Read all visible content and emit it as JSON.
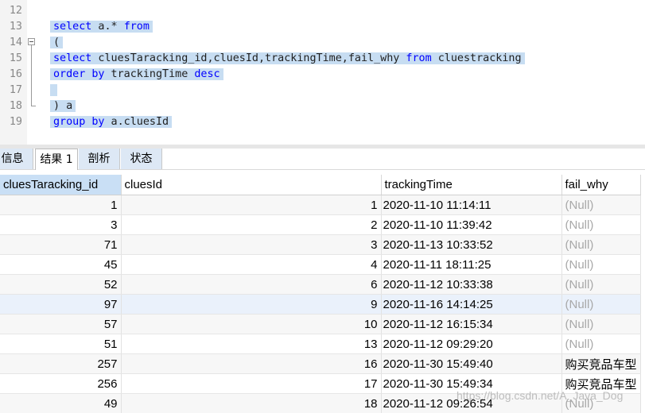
{
  "editor": {
    "line_numbers": [
      "12",
      "13",
      "14",
      "15",
      "16",
      "17",
      "18",
      "19"
    ],
    "lines": [
      {
        "num": "12",
        "tokens": []
      },
      {
        "num": "13",
        "tokens": [
          {
            "t": "select",
            "k": true
          },
          {
            "t": " a.* ",
            "k": false
          },
          {
            "t": "from",
            "k": true
          }
        ]
      },
      {
        "num": "14",
        "tokens": [
          {
            "t": "(",
            "k": false
          }
        ]
      },
      {
        "num": "15",
        "tokens": [
          {
            "t": "select",
            "k": true
          },
          {
            "t": " cluesTaracking_id,cluesId,trackingTime,fail_why ",
            "k": false
          },
          {
            "t": "from",
            "k": true
          },
          {
            "t": " cluestracking",
            "k": false
          }
        ]
      },
      {
        "num": "16",
        "tokens": [
          {
            "t": "order",
            "k": true
          },
          {
            "t": " ",
            "k": false
          },
          {
            "t": "by",
            "k": true
          },
          {
            "t": " trackingTime ",
            "k": false
          },
          {
            "t": "desc",
            "k": true
          }
        ]
      },
      {
        "num": "17",
        "tokens": []
      },
      {
        "num": "18",
        "tokens": [
          {
            "t": ") a",
            "k": false
          }
        ]
      },
      {
        "num": "19",
        "tokens": [
          {
            "t": "group",
            "k": true
          },
          {
            "t": " ",
            "k": false
          },
          {
            "t": "by",
            "k": true
          },
          {
            "t": " a.cluesId",
            "k": false
          }
        ]
      }
    ]
  },
  "tabs": {
    "info": "信息",
    "result": "结果 1",
    "profile": "剖析",
    "status": "状态"
  },
  "grid": {
    "columns": [
      "cluesTaracking_id",
      "cluesId",
      "trackingTime",
      "fail_why"
    ],
    "rows": [
      [
        "1",
        "1",
        "2020-11-10 11:14:11",
        "(Null)"
      ],
      [
        "3",
        "2",
        "2020-11-10 11:39:42",
        "(Null)"
      ],
      [
        "71",
        "3",
        "2020-11-13 10:33:52",
        "(Null)"
      ],
      [
        "45",
        "4",
        "2020-11-11 18:11:25",
        "(Null)"
      ],
      [
        "52",
        "6",
        "2020-11-12 10:33:38",
        "(Null)"
      ],
      [
        "97",
        "9",
        "2020-11-16 14:14:25",
        "(Null)"
      ],
      [
        "57",
        "10",
        "2020-11-12 16:15:34",
        "(Null)"
      ],
      [
        "51",
        "13",
        "2020-11-12 09:29:20",
        "(Null)"
      ],
      [
        "257",
        "16",
        "2020-11-30 15:49:40",
        "购买竞品车型"
      ],
      [
        "256",
        "17",
        "2020-11-30 15:49:34",
        "购买竞品车型"
      ],
      [
        "49",
        "18",
        "2020-11-12 09:26:54",
        "(Null)"
      ]
    ]
  },
  "watermark": "https://blog.csdn.net/A_Java_Dog",
  "colors": {
    "keyword": "#0000ff",
    "selection": "#c7ddf2",
    "null_text": "#a8a8a8",
    "tab_bg": "#dde8f5"
  }
}
